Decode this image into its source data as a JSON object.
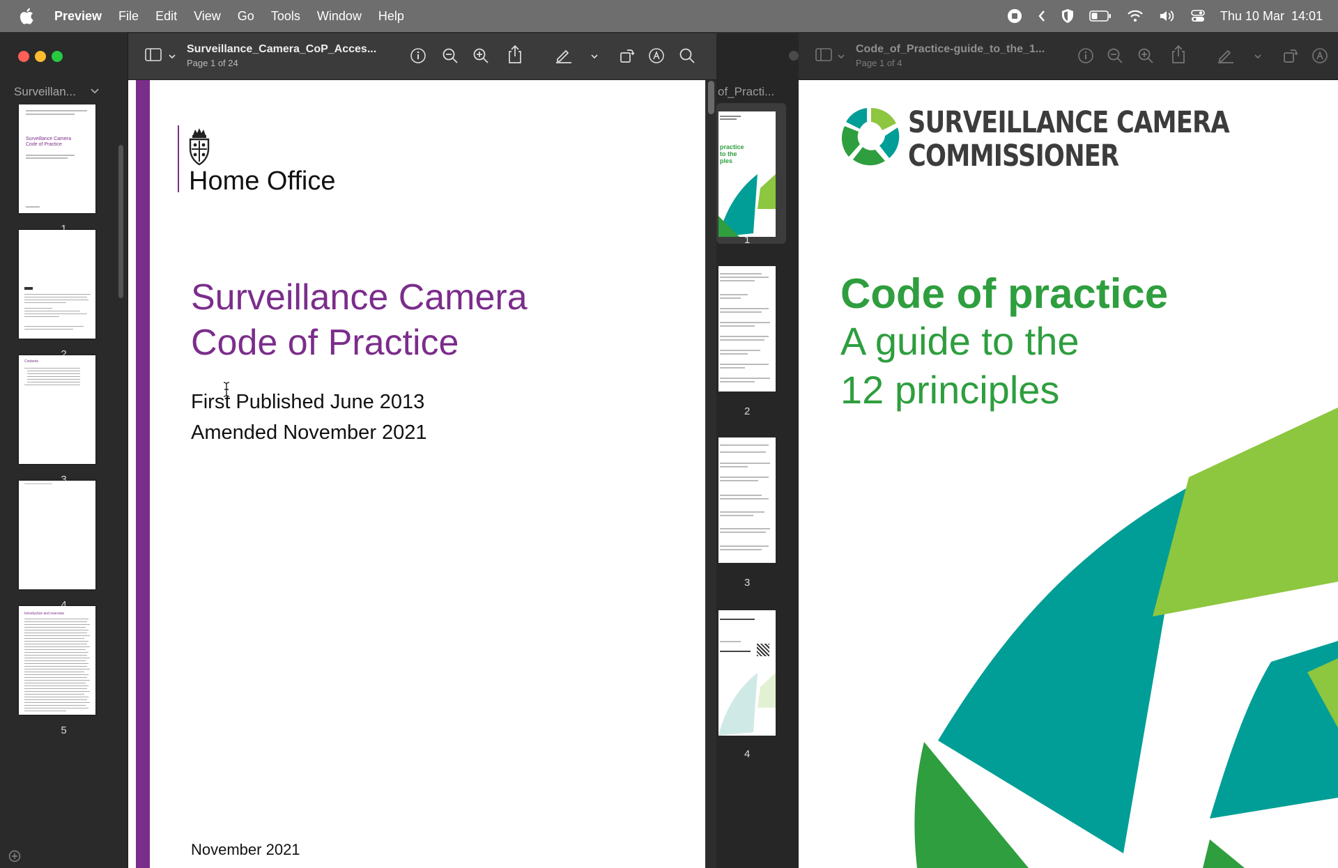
{
  "menubar": {
    "app": "Preview",
    "items": [
      "File",
      "Edit",
      "View",
      "Go",
      "Tools",
      "Window",
      "Help"
    ],
    "clock": "Thu 10 Mar  14:01"
  },
  "left_window": {
    "sidebar_title": "Surveillan...",
    "thumbnails": [
      {
        "page": "1",
        "lines": [
          "Surveillance Camera",
          "Code of Practice"
        ]
      },
      {
        "page": "2"
      },
      {
        "page": "3",
        "heading": "Contents"
      },
      {
        "page": "4"
      },
      {
        "page": "5",
        "heading": "Introduction and overview"
      }
    ],
    "doc_title": "Surveillance_Camera_CoP_Acces...",
    "page_indicator": "Page 1 of 24",
    "page": {
      "org": "Home Office",
      "title_line1": "Surveillance Camera",
      "title_line2": "Code of Practice",
      "published": "First Published June 2013",
      "amended": "Amended November 2021",
      "footer_date": "November 2021"
    }
  },
  "right_window": {
    "sidebar_title": "of_Practi...",
    "thumbnails": [
      {
        "page": "1",
        "lines": [
          "practice",
          "to the",
          "ples"
        ]
      },
      {
        "page": "2"
      },
      {
        "page": "3"
      },
      {
        "page": "4"
      }
    ],
    "doc_title": "Code_of_Practice-guide_to_the_1...",
    "page_indicator": "Page 1 of 4",
    "page": {
      "brand_line1": "SURVEILLANCE CAMERA",
      "brand_line2": "COMMISSIONER",
      "heading": "Code of practice",
      "sub_line1": "A guide to the",
      "sub_line2": "12 principles"
    }
  },
  "colors": {
    "ho_purple": "#7b2d8b",
    "sc_green": "#2e9e3e",
    "sc_teal": "#009e96",
    "sc_lime": "#8dc63f"
  }
}
